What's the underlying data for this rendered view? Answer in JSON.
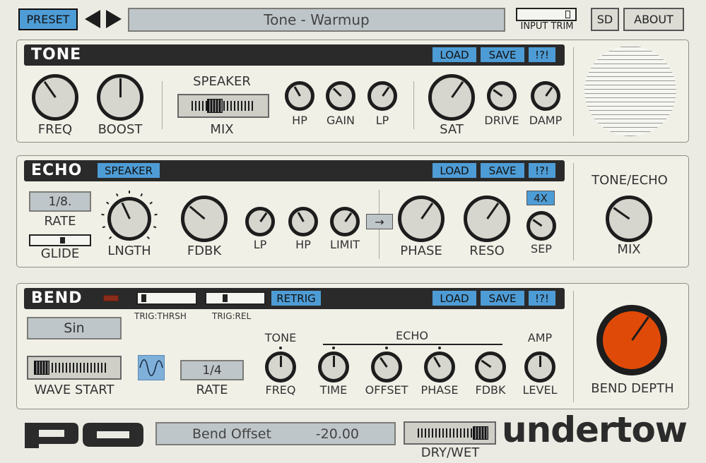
{
  "header": {
    "preset_label": "PRESET",
    "preset_name": "Tone - Warmup",
    "input_trim_label": "INPUT TRIM",
    "sd_label": "SD",
    "about_label": "ABOUT",
    "input_trim_level": 0.92
  },
  "tone": {
    "title": "TONE",
    "load": "LOAD",
    "save": "SAVE",
    "info": "!?!",
    "freq": "FREQ",
    "boost": "BOOST",
    "speaker": "SPEAKER",
    "mix": "MIX",
    "hp": "HP",
    "gain": "GAIN",
    "lp": "LP",
    "sat": "SAT",
    "drive": "DRIVE",
    "damp": "DAMP"
  },
  "echo": {
    "title": "ECHO",
    "speaker_btn": "SPEAKER",
    "load": "LOAD",
    "save": "SAVE",
    "info": "!?!",
    "rate_value": "1/8.",
    "rate": "RATE",
    "glide": "GLIDE",
    "glide_level": 0.55,
    "length": "LNGTH",
    "fdbk": "FDBK",
    "lp": "LP",
    "hp": "HP",
    "limit": "LIMIT",
    "arrow": "→",
    "phase": "PHASE",
    "reso": "RESO",
    "mult": "4X",
    "sep": "SEP",
    "tone_echo": "TONE/ECHO",
    "mix": "MIX"
  },
  "bend": {
    "title": "BEND",
    "trig_thrsh": "TRIG:THRSH",
    "trig_rel": "TRIG:REL",
    "trig_thrsh_level": 0.06,
    "trig_rel_level": 0.3,
    "retrig": "RETRIG",
    "load": "LOAD",
    "save": "SAVE",
    "info": "!?!",
    "wave": "Sin",
    "wave_start": "WAVE START",
    "rate_value": "1/4",
    "rate": "RATE",
    "tone": "TONE",
    "freq": "FREQ",
    "echo": "ECHO",
    "time": "TIME",
    "offset": "OFFSET",
    "phase": "PHASE",
    "fdbk": "FDBK",
    "amp": "AMP",
    "level": "LEVEL",
    "bend_depth": "BEND DEPTH"
  },
  "footer": {
    "param_name": "Bend Offset",
    "param_value": "-20.00",
    "dry_wet": "DRY/WET",
    "brand": "undertow"
  },
  "colors": {
    "accent_blue": "#4e9cd5",
    "bend_depth_knob": "#e04a08",
    "titlebar": "#2a2a2a"
  }
}
